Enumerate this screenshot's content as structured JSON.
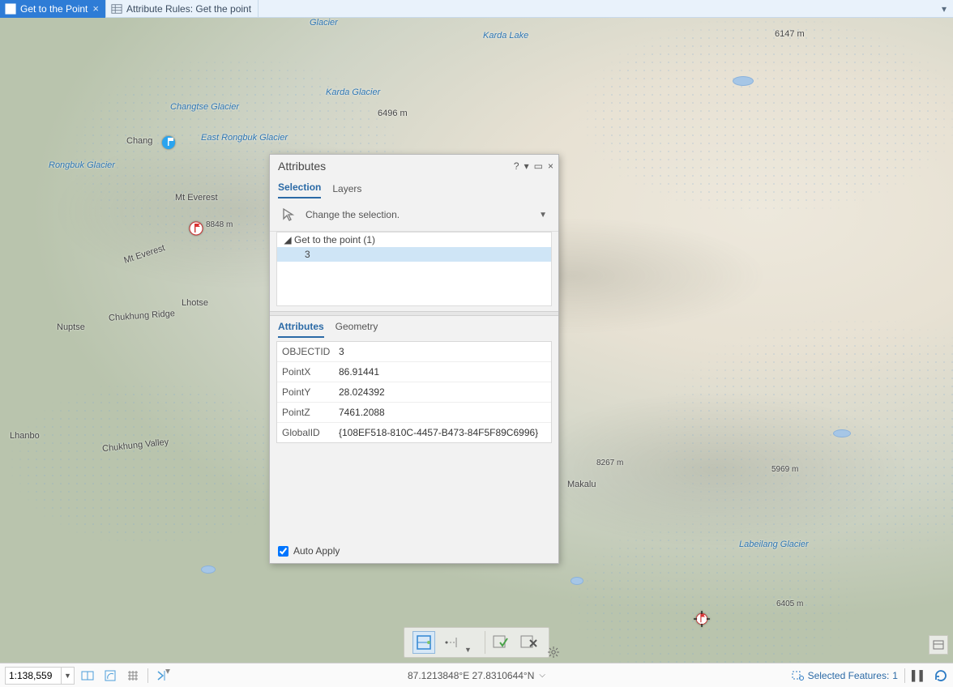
{
  "tabs": {
    "active_label": "Get to the Point",
    "second_label": "Attribute Rules: Get the point"
  },
  "attributes_panel": {
    "title": "Attributes",
    "main_tabs": {
      "selection": "Selection",
      "layers": "Layers"
    },
    "change_selection": "Change the selection.",
    "tree": {
      "layer_label": "Get to the point (1)",
      "selected_feature": "3"
    },
    "sub_tabs": {
      "attributes": "Attributes",
      "geometry": "Geometry"
    },
    "fields": [
      {
        "k": "OBJECTID",
        "v": "3"
      },
      {
        "k": "PointX",
        "v": "86.91441"
      },
      {
        "k": "PointY",
        "v": "28.024392"
      },
      {
        "k": "PointZ",
        "v": "7461.2088"
      },
      {
        "k": "GlobalID",
        "v": "{108EF518-810C-4457-B473-84F5F89C6996}"
      }
    ],
    "auto_apply_label": "Auto Apply",
    "auto_apply_checked": true
  },
  "map_labels": {
    "glacier_top": "Glacier",
    "karda_lake": "Karda\nLake",
    "karda_glacier": "Karda\nGlacier",
    "changtse_glacier": "Changtse\nGlacier",
    "east_rongbuk_glacier": "East\nRongbuk\nGlacier",
    "chang": "Chang",
    "rongbuk_glacier": "Rongbuk\nGlacier",
    "mt_everest": "Mt Everest",
    "mt_everest_ridge": "Mt Everest",
    "lhotse": "Lhotse",
    "chukhung_ridge": "Chukhung Ridge",
    "nuptse": "Nuptse",
    "chukhung_valley": "Chukhung Valley",
    "lhanbo": "Lhanbo",
    "makalu": "Makalu",
    "labeilang_glacier": "Labeilang\nGlacier",
    "elev_6147": "6147 m",
    "elev_6496": "6496 m",
    "elev_8848": "8848 m",
    "elev_8267": "8267 m",
    "elev_5969": "5969 m",
    "elev_6405": "6405 m"
  },
  "status": {
    "scale": "1:138,559",
    "coords": "87.1213848°E 27.8310644°N",
    "selected_features_label": "Selected Features:",
    "selected_features_count": "1"
  },
  "icons": {
    "map_tab": "map-icon",
    "rules_tab": "table-rules-icon"
  }
}
